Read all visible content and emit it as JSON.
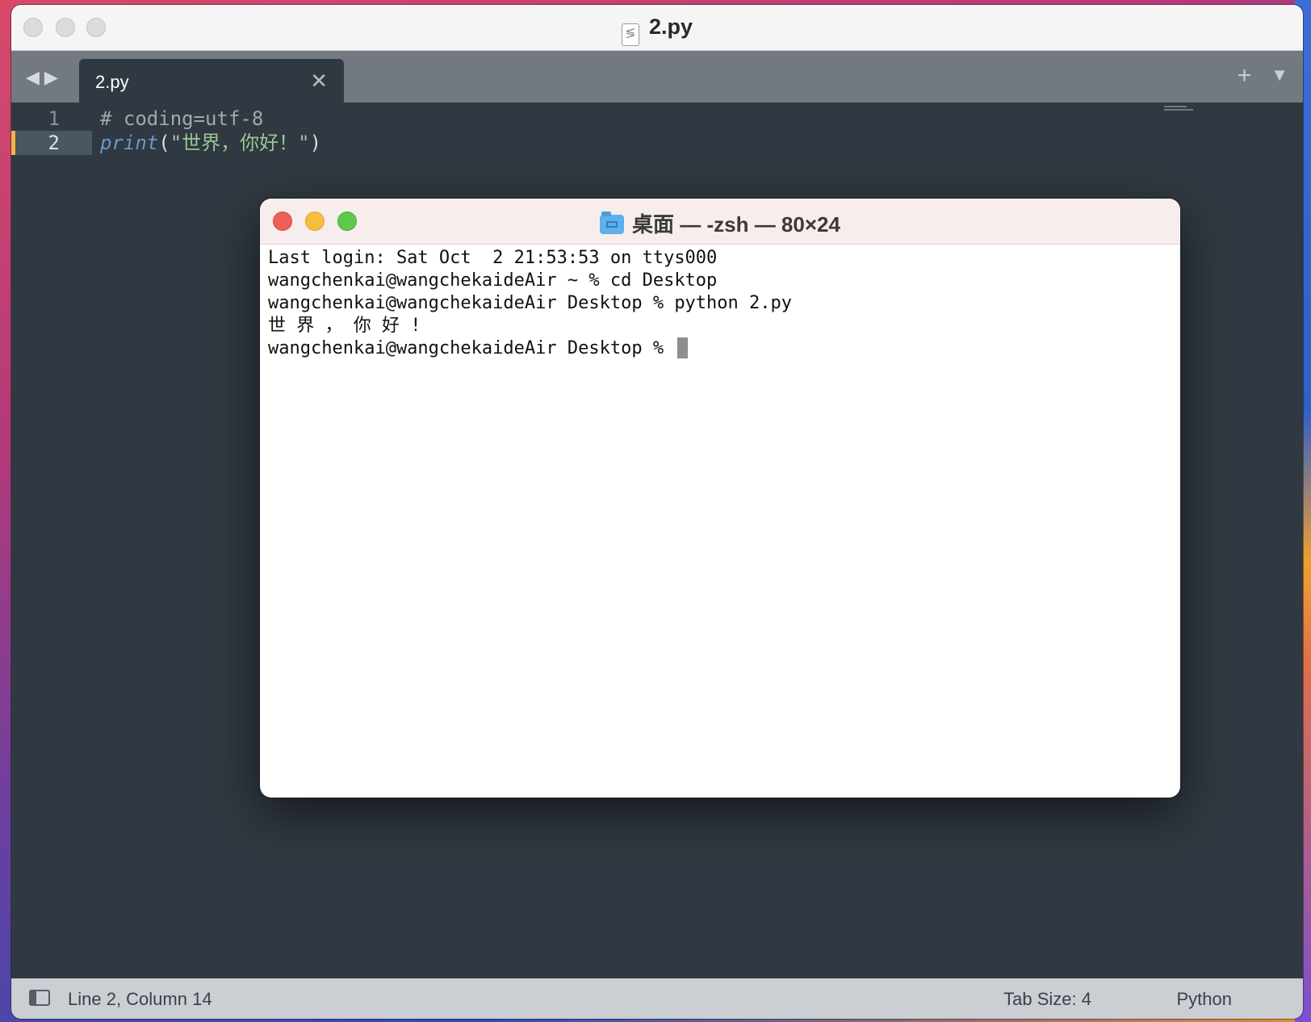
{
  "editor": {
    "title": "2.py",
    "tab": {
      "label": "2.py",
      "close": "✕"
    },
    "nav": {
      "back": "◀",
      "forward": "▶"
    },
    "tab_actions": {
      "new": "+",
      "menu": "▼"
    },
    "lines": [
      {
        "number": "1",
        "comment": "# coding=utf-8"
      },
      {
        "number": "2",
        "fn": "print",
        "open": "(",
        "string": "\"世界，你好！\"",
        "close": ")"
      }
    ],
    "status": {
      "position": "Line 2, Column 14",
      "tab_size": "Tab Size: 4",
      "syntax": "Python"
    }
  },
  "terminal": {
    "title": "桌面 — -zsh — 80×24",
    "lines": [
      "Last login: Sat Oct  2 21:53:53 on ttys000",
      "wangchenkai@wangchekaideAir ~ % cd Desktop",
      "wangchenkai@wangchekaideAir Desktop % python 2.py",
      "世 界 ， 你 好 !",
      "wangchenkai@wangchekaideAir Desktop % "
    ]
  },
  "colors": {
    "editor_bg": "#303841",
    "tab_bar": "#737980",
    "status_bar": "#cbced3",
    "active_line_marker": "#f6b24d",
    "function": "#6699cc",
    "string": "#99c794"
  },
  "icons": {
    "file": "python-file-icon",
    "folder": "folder-icon",
    "sidebar_toggle": "sidebar-toggle-icon"
  }
}
